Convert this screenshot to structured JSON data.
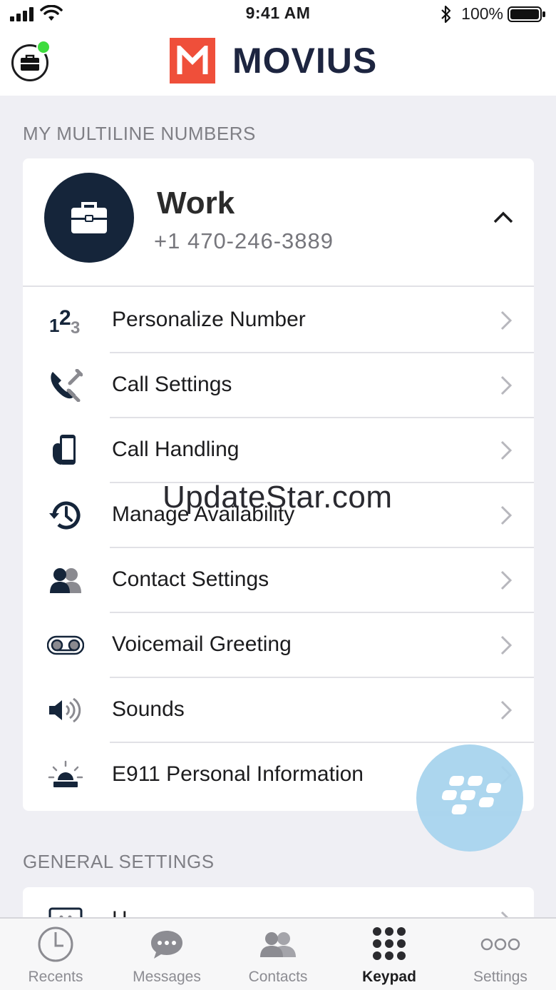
{
  "status_bar": {
    "time": "9:41 AM",
    "battery": "100%"
  },
  "header": {
    "logo_text": "MOVIUS",
    "logo_color": "#ef4f3a",
    "work_mode_icon": "briefcase-icon",
    "online_color": "#3ddc3d"
  },
  "multiline": {
    "section_title": "MY MULTILINE NUMBERS",
    "account": {
      "name": "Work",
      "number": "+1 470-246-3889"
    },
    "items": [
      {
        "label": "Personalize Number",
        "icon": "number-123-icon"
      },
      {
        "label": "Call Settings",
        "icon": "phone-wrench-icon"
      },
      {
        "label": "Call Handling",
        "icon": "hand-phone-icon"
      },
      {
        "label": "Manage Availability",
        "icon": "history-clock-icon"
      },
      {
        "label": "Contact Settings",
        "icon": "contacts-icon"
      },
      {
        "label": "Voicemail Greeting",
        "icon": "voicemail-icon"
      },
      {
        "label": "Sounds",
        "icon": "speaker-icon"
      },
      {
        "label": "E911 Personal Information",
        "icon": "siren-icon"
      }
    ]
  },
  "general": {
    "section_title": "GENERAL SETTINGS",
    "first_item_partial": "H"
  },
  "watermark": "UpdateStar.com",
  "tabs": [
    {
      "label": "Recents",
      "icon": "clock-icon",
      "active": false
    },
    {
      "label": "Messages",
      "icon": "chat-bubble-icon",
      "active": false
    },
    {
      "label": "Contacts",
      "icon": "contacts-icon",
      "active": false
    },
    {
      "label": "Keypad",
      "icon": "keypad-icon",
      "active": true
    },
    {
      "label": "Settings",
      "icon": "more-dots-icon",
      "active": false
    }
  ]
}
